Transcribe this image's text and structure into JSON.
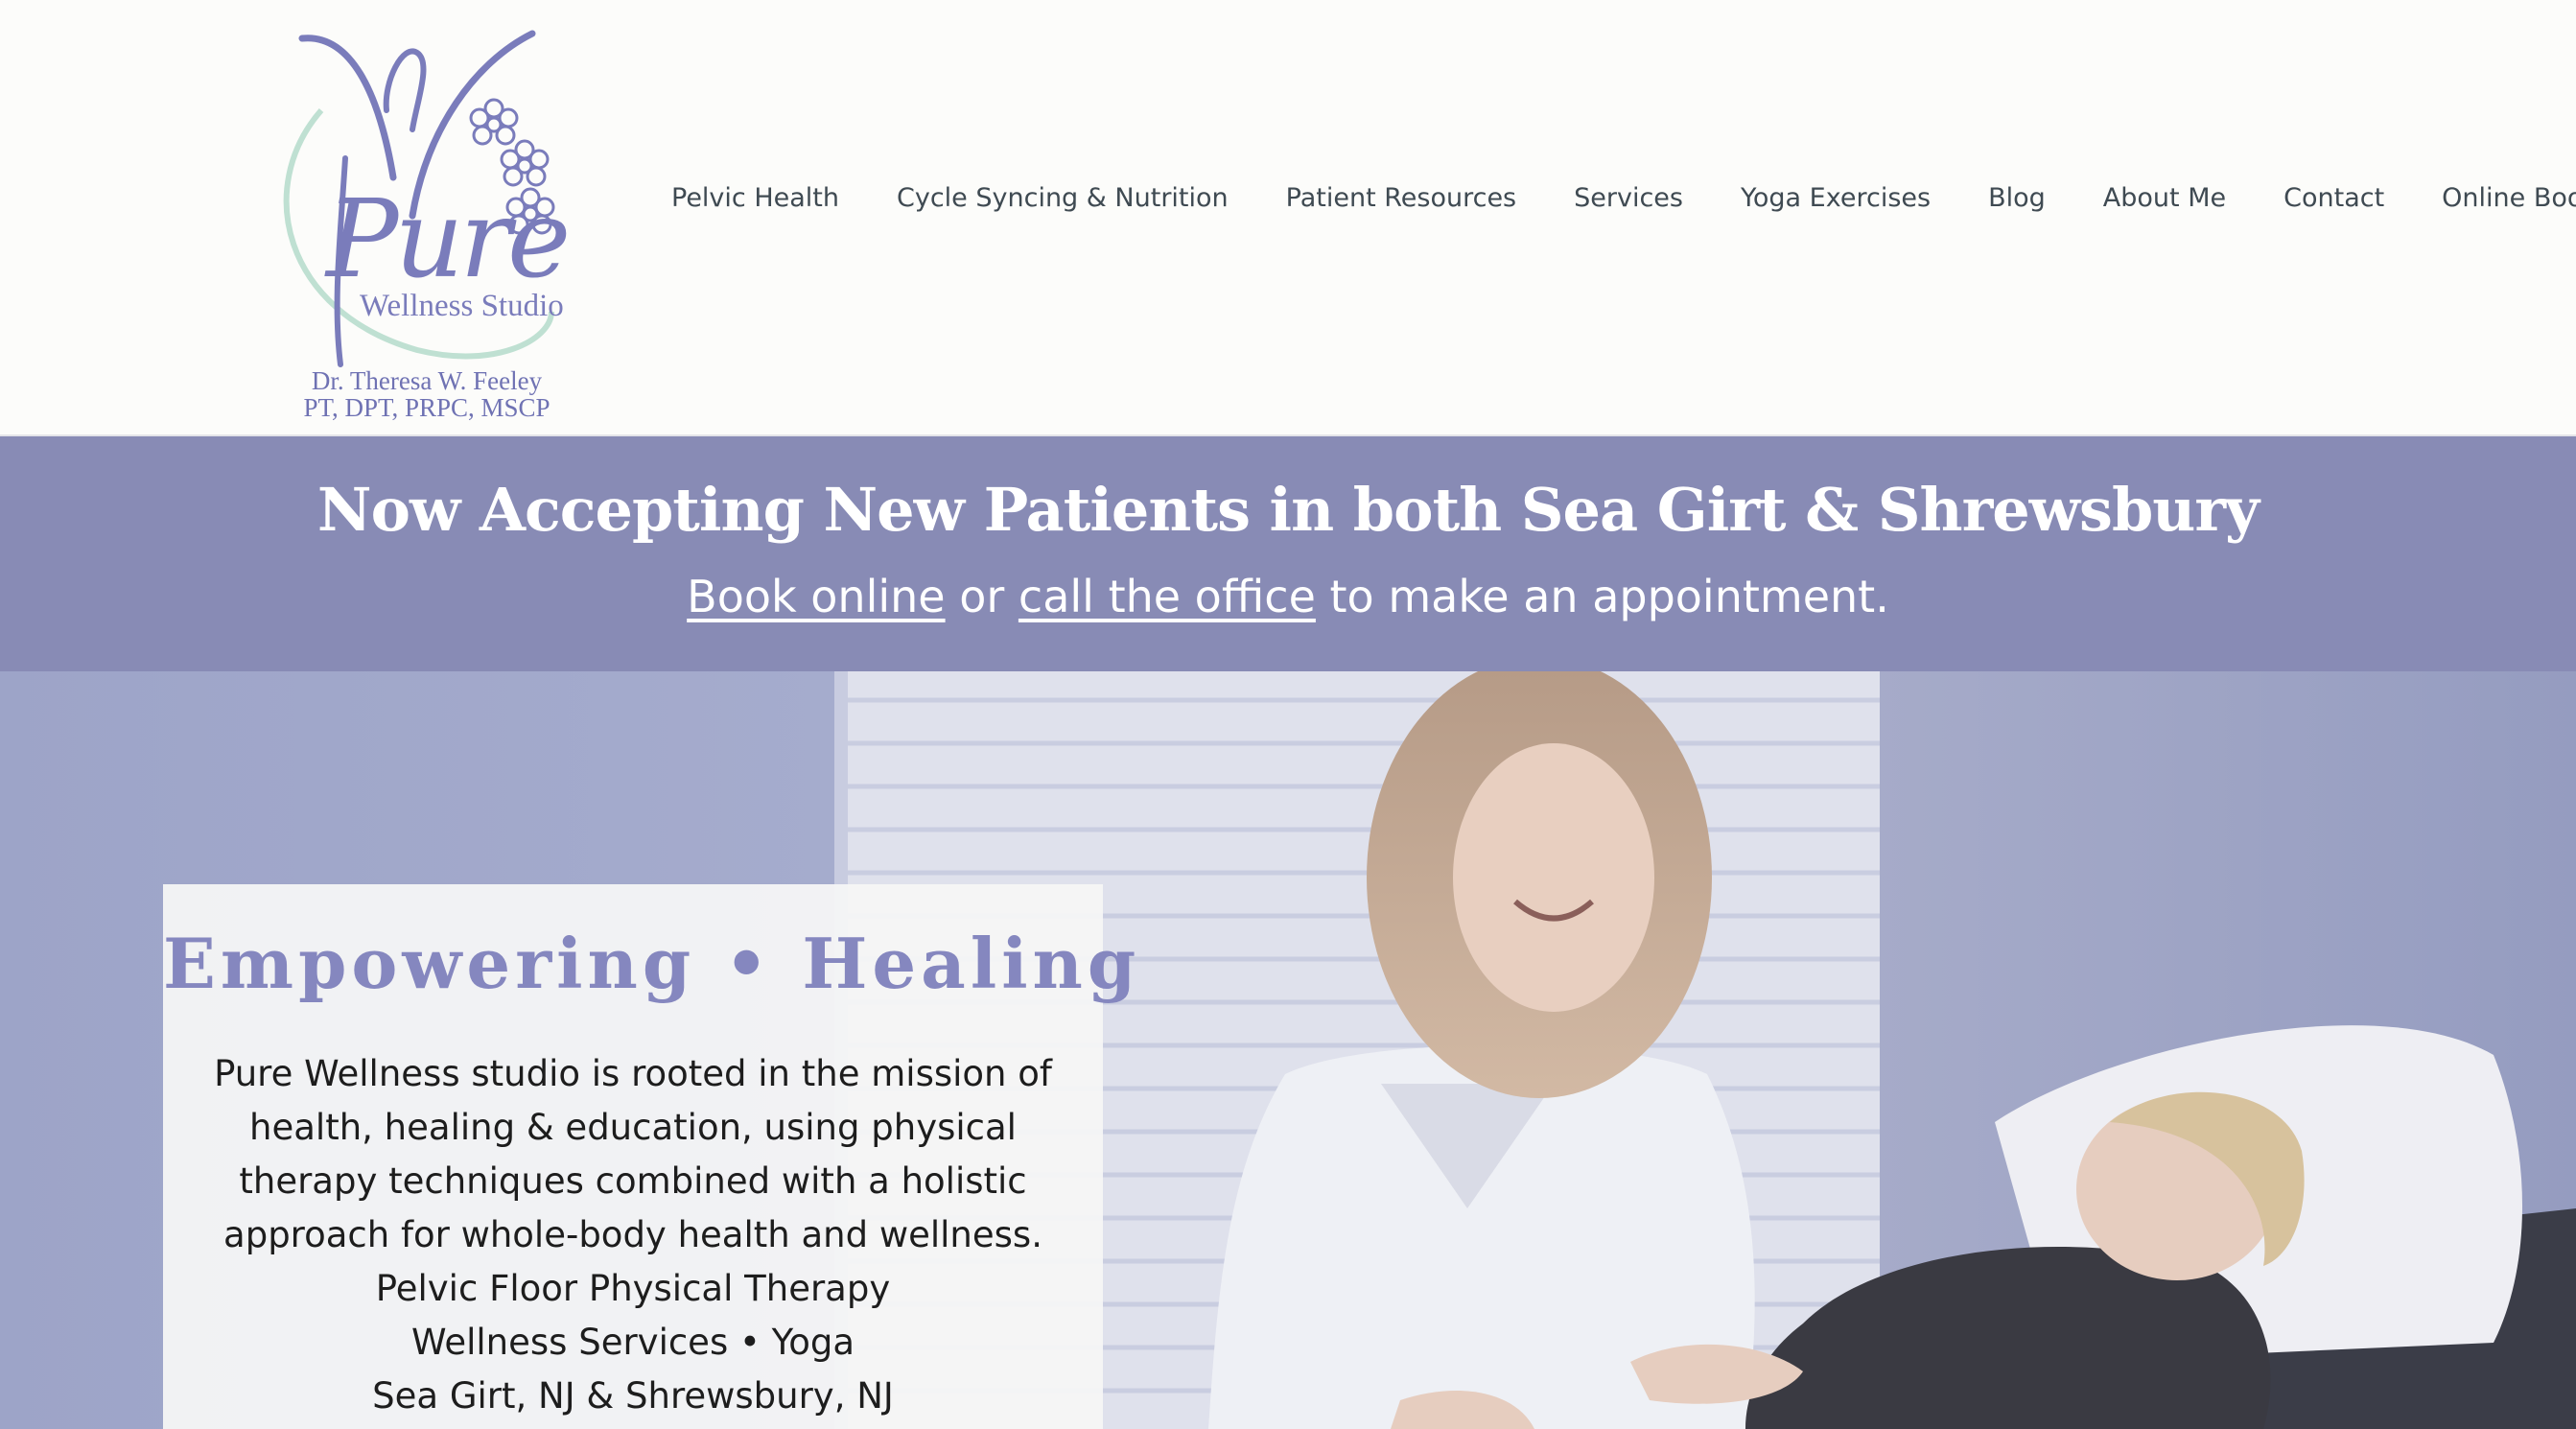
{
  "logo": {
    "script": "Pure",
    "subtitle": "Wellness Studio",
    "name": "Dr. Theresa W. Feeley",
    "credentials": "PT, DPT, PRPC, MSCP"
  },
  "nav": {
    "items": [
      {
        "label": "Pelvic Health"
      },
      {
        "label": "Cycle Syncing & Nutrition"
      },
      {
        "label": "Patient Resources"
      },
      {
        "label": "Services"
      },
      {
        "label": "Yoga Exercises"
      },
      {
        "label": "Blog"
      },
      {
        "label": "About Me"
      },
      {
        "label": "Contact"
      },
      {
        "label": "Online Booking"
      }
    ]
  },
  "banner": {
    "title": "Now Accepting New Patients in both Sea Girt & Shrewsbury",
    "book_link": "Book online",
    "or_text": " or ",
    "call_link": "call the office",
    "suffix": " to make an appointment."
  },
  "hero": {
    "card_title": "Empowering • Healing",
    "lines": [
      "Pure Wellness studio is rooted in the mission of",
      "health, healing & education, using physical",
      "therapy techniques combined with a holistic",
      "approach for whole-body health and wellness.",
      "Pelvic Floor Physical Therapy",
      "Wellness Services • Yoga",
      "Sea Girt, NJ & Shrewsbury, NJ"
    ]
  },
  "colors": {
    "brand_purple": "#888bb5",
    "logo_purple": "#7a7cbb",
    "nav_text": "#3f4a52",
    "card_title": "#8587bf"
  }
}
